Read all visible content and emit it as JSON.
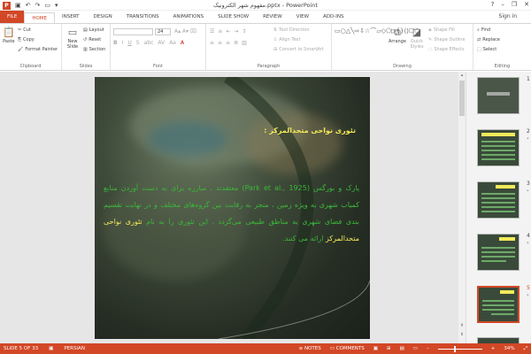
{
  "window": {
    "title": "مفهوم شهر الکترونیک.pptx - PowerPoint",
    "controls": [
      "?",
      "–",
      "❐",
      "✕"
    ]
  },
  "tabs": [
    "FILE",
    "HOME",
    "INSERT",
    "DESIGN",
    "TRANSITIONS",
    "ANIMATIONS",
    "SLIDE SHOW",
    "REVIEW",
    "VIEW",
    "ADD-INS"
  ],
  "active_tab": "HOME",
  "signin": "Sign in",
  "ribbon": {
    "clipboard": {
      "label": "Clipboard",
      "paste": "Paste",
      "cut": "Cut",
      "copy": "Copy",
      "format_painter": "Format Painter"
    },
    "slides": {
      "label": "Slides",
      "new_slide": "New Slide",
      "layout": "Layout",
      "reset": "Reset",
      "section": "Section"
    },
    "font": {
      "label": "Font",
      "size": "24"
    },
    "paragraph": {
      "label": "Paragraph",
      "text_direction": "Text Direction",
      "align_text": "Align Text",
      "convert_smartart": "Convert to SmartArt"
    },
    "drawing": {
      "label": "Drawing",
      "arrange": "Arrange",
      "quick_styles": "Quick Styles",
      "shape_fill": "Shape Fill",
      "shape_outline": "Shape Outline",
      "shape_effects": "Shape Effects"
    },
    "editing": {
      "label": "Editing",
      "find": "Find",
      "replace": "Replace",
      "select": "Select"
    }
  },
  "slide": {
    "title": "تئوری نواحی متحدالمرکز :",
    "body_green": "پارک و بورگس (Park et al., 1925) معتقدند ، مبارزه برای به دست آوردن منابع کمیاب شهری به ویژه زمین ، منجر به رقابت بین گروه‌های مختلف و در نهایت تقسیم بندی فضای شهری به مناطق طبیعی می‌گردد . این تئوری را به نام",
    "body_highlight": "تئوری نواحی متحدالمرکز",
    "body_end": "ارائه می کنند."
  },
  "thumbnails": [
    {
      "number": "1",
      "star": ""
    },
    {
      "number": "2",
      "star": "*"
    },
    {
      "number": "3",
      "star": "*"
    },
    {
      "number": "4",
      "star": "*"
    },
    {
      "number": "5",
      "star": "*"
    }
  ],
  "selected_slide": 5,
  "status": {
    "slide_of": "SLIDE 5 OF 33",
    "language": "PERSIAN",
    "notes": "NOTES",
    "comments": "COMMENTS",
    "zoom": "34%"
  },
  "colors": {
    "accent": "#d24726",
    "title_yellow": "#f2ea5a",
    "body_green": "#3cb83a"
  }
}
